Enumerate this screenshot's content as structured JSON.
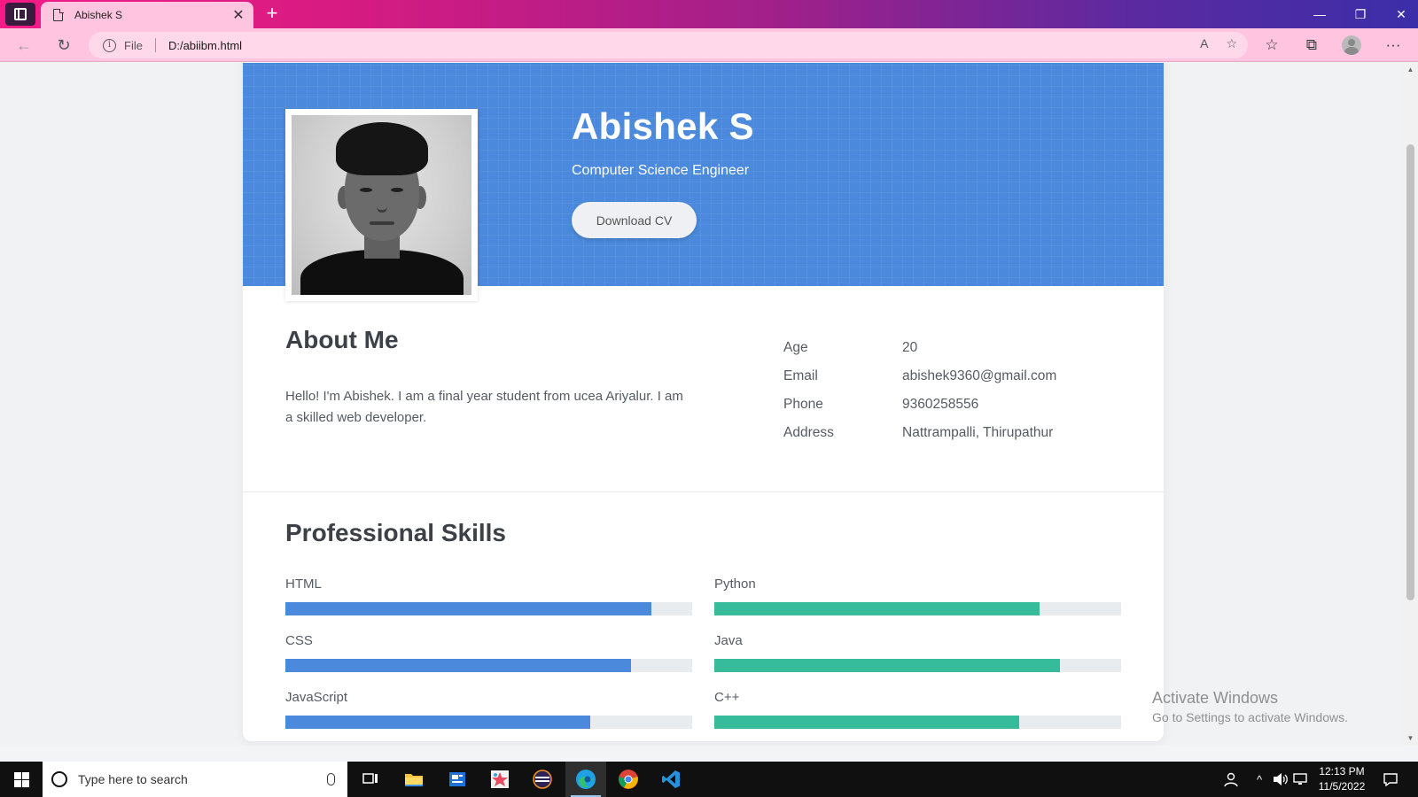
{
  "browser": {
    "tab_title": "Abishek S",
    "tab_close": "✕",
    "new_tab": "+",
    "address_scheme": "File",
    "address_url": "D:/abiibm.html",
    "info_glyph": "i",
    "window_controls": {
      "minimize": "—",
      "restore": "❐",
      "close": "✕"
    },
    "nav": {
      "back": "←",
      "refresh": "↻"
    },
    "omni_icons": {
      "read_aloud": "A",
      "add_favorite": "☆"
    },
    "toolbar": {
      "favorites": "☆",
      "collections": "⧉",
      "more": "···"
    }
  },
  "profile": {
    "name": "Abishek S",
    "role": "Computer Science Engineer",
    "download_label": "Download CV"
  },
  "about": {
    "title": "About Me",
    "text": "Hello! I'm Abishek. I am a final year student from ucea Ariyalur. I am a skilled web developer.",
    "info": [
      {
        "label": "Age",
        "value": "20"
      },
      {
        "label": "Email",
        "value": "abishek9360@gmail.com"
      },
      {
        "label": "Phone",
        "value": "9360258556"
      },
      {
        "label": "Address",
        "value": "Nattrampalli, Thirupathur"
      }
    ]
  },
  "skills": {
    "title": "Professional Skills",
    "left_color": "#4a89dc",
    "right_color": "#37bc9b",
    "items": [
      {
        "name": "HTML",
        "level": 0.9
      },
      {
        "name": "Python",
        "level": 0.8
      },
      {
        "name": "CSS",
        "level": 0.85
      },
      {
        "name": "Java",
        "level": 0.85
      },
      {
        "name": "JavaScript",
        "level": 0.75
      },
      {
        "name": "C++",
        "level": 0.75
      }
    ]
  },
  "watermark": {
    "line1": "Activate Windows",
    "line2": "Go to Settings to activate Windows."
  },
  "taskbar": {
    "search_placeholder": "Type here to search",
    "time": "12:13 PM",
    "date": "11/5/2022",
    "tray_up": "^",
    "apps": [
      "task-view-icon",
      "file-explorer-icon",
      "news-icon",
      "paint-icon",
      "eclipse-icon",
      "edge-icon",
      "chrome-icon",
      "vscode-icon"
    ]
  },
  "colors": {
    "hero": "#4a89dc",
    "titlebar_start": "#f41b86",
    "titlebar_end": "#3b2ea8",
    "addressbar": "#ffc4e0"
  }
}
